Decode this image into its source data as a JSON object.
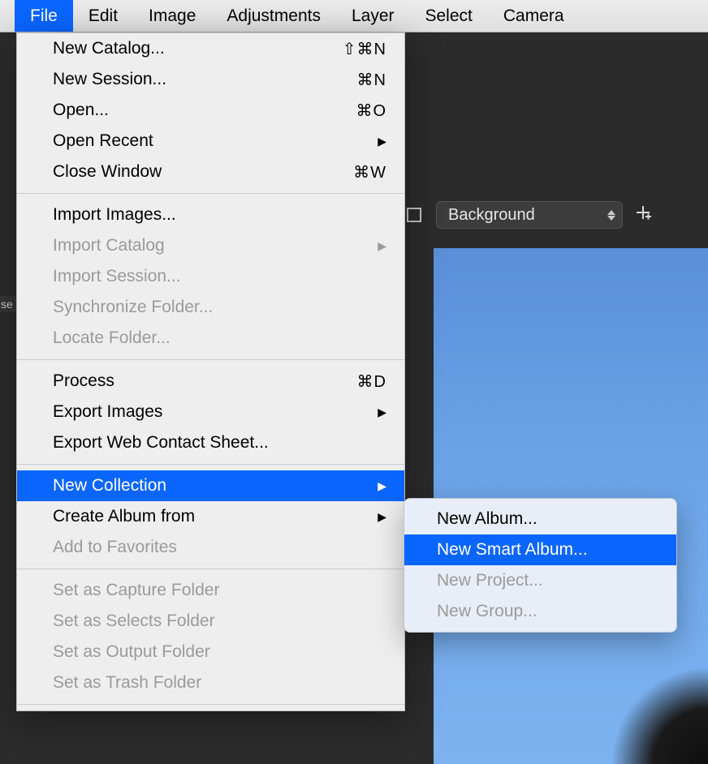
{
  "menubar": {
    "items": [
      {
        "label": "File",
        "active": true
      },
      {
        "label": "Edit",
        "active": false
      },
      {
        "label": "Image",
        "active": false
      },
      {
        "label": "Adjustments",
        "active": false
      },
      {
        "label": "Layer",
        "active": false
      },
      {
        "label": "Select",
        "active": false
      },
      {
        "label": "Camera",
        "active": false
      }
    ]
  },
  "toolbar": {
    "dropdown_label": "Background"
  },
  "sidebar": {
    "fragment": "se"
  },
  "file_menu": {
    "groups": [
      [
        {
          "label": "New Catalog...",
          "shortcut": "⇧⌘N",
          "enabled": true,
          "submenu": false
        },
        {
          "label": "New Session...",
          "shortcut": "⌘N",
          "enabled": true,
          "submenu": false
        },
        {
          "label": "Open...",
          "shortcut": "⌘O",
          "enabled": true,
          "submenu": false
        },
        {
          "label": "Open Recent",
          "shortcut": "",
          "enabled": true,
          "submenu": true
        },
        {
          "label": "Close Window",
          "shortcut": "⌘W",
          "enabled": true,
          "submenu": false
        }
      ],
      [
        {
          "label": "Import Images...",
          "shortcut": "",
          "enabled": true,
          "submenu": false
        },
        {
          "label": "Import Catalog",
          "shortcut": "",
          "enabled": false,
          "submenu": true
        },
        {
          "label": "Import Session...",
          "shortcut": "",
          "enabled": false,
          "submenu": false
        },
        {
          "label": "Synchronize Folder...",
          "shortcut": "",
          "enabled": false,
          "submenu": false
        },
        {
          "label": "Locate Folder...",
          "shortcut": "",
          "enabled": false,
          "submenu": false
        }
      ],
      [
        {
          "label": "Process",
          "shortcut": "⌘D",
          "enabled": true,
          "submenu": false
        },
        {
          "label": "Export Images",
          "shortcut": "",
          "enabled": true,
          "submenu": true
        },
        {
          "label": "Export Web Contact Sheet...",
          "shortcut": "",
          "enabled": true,
          "submenu": false
        }
      ],
      [
        {
          "label": "New Collection",
          "shortcut": "",
          "enabled": true,
          "submenu": true,
          "highlighted": true
        },
        {
          "label": "Create Album from",
          "shortcut": "",
          "enabled": true,
          "submenu": true
        },
        {
          "label": "Add to Favorites",
          "shortcut": "",
          "enabled": false,
          "submenu": false
        }
      ],
      [
        {
          "label": "Set as Capture Folder",
          "shortcut": "",
          "enabled": false,
          "submenu": false
        },
        {
          "label": "Set as Selects Folder",
          "shortcut": "",
          "enabled": false,
          "submenu": false
        },
        {
          "label": "Set as Output Folder",
          "shortcut": "",
          "enabled": false,
          "submenu": false
        },
        {
          "label": "Set as Trash Folder",
          "shortcut": "",
          "enabled": false,
          "submenu": false
        }
      ]
    ]
  },
  "submenu": {
    "items": [
      {
        "label": "New Album...",
        "enabled": true,
        "highlighted": false
      },
      {
        "label": "New Smart Album...",
        "enabled": true,
        "highlighted": true
      },
      {
        "label": "New Project...",
        "enabled": false,
        "highlighted": false
      },
      {
        "label": "New Group...",
        "enabled": false,
        "highlighted": false
      }
    ]
  }
}
